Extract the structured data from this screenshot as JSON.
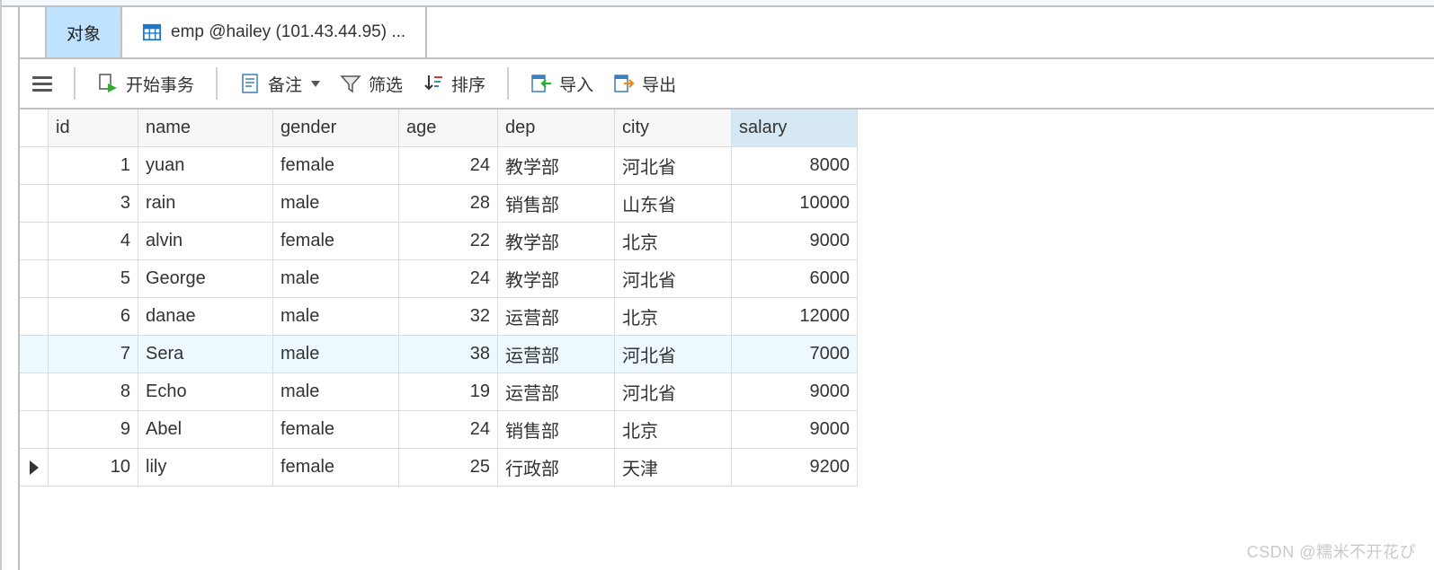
{
  "tabs": {
    "active_label": "对象",
    "inactive_label": "emp @hailey (101.43.44.95) ..."
  },
  "toolbar": {
    "begin_tx": "开始事务",
    "memo": "备注",
    "filter": "筛选",
    "sort": "排序",
    "import": "导入",
    "export": "导出"
  },
  "columns": [
    "id",
    "name",
    "gender",
    "age",
    "dep",
    "city",
    "salary"
  ],
  "sorted_column": "salary",
  "selected_row_index": 5,
  "current_row_index": 8,
  "rows": [
    {
      "id": 1,
      "name": "yuan",
      "gender": "female",
      "age": 24,
      "dep": "教学部",
      "city": "河北省",
      "salary": 8000
    },
    {
      "id": 3,
      "name": "rain",
      "gender": "male",
      "age": 28,
      "dep": "销售部",
      "city": "山东省",
      "salary": 10000
    },
    {
      "id": 4,
      "name": "alvin",
      "gender": "female",
      "age": 22,
      "dep": "教学部",
      "city": "北京",
      "salary": 9000
    },
    {
      "id": 5,
      "name": "George",
      "gender": "male",
      "age": 24,
      "dep": "教学部",
      "city": "河北省",
      "salary": 6000
    },
    {
      "id": 6,
      "name": "danae",
      "gender": "male",
      "age": 32,
      "dep": "运营部",
      "city": "北京",
      "salary": 12000
    },
    {
      "id": 7,
      "name": "Sera",
      "gender": "male",
      "age": 38,
      "dep": "运营部",
      "city": "河北省",
      "salary": 7000
    },
    {
      "id": 8,
      "name": "Echo",
      "gender": "male",
      "age": 19,
      "dep": "运营部",
      "city": "河北省",
      "salary": 9000
    },
    {
      "id": 9,
      "name": "Abel",
      "gender": "female",
      "age": 24,
      "dep": "销售部",
      "city": "北京",
      "salary": 9000
    },
    {
      "id": 10,
      "name": "lily",
      "gender": "female",
      "age": 25,
      "dep": "行政部",
      "city": "天津",
      "salary": 9200
    }
  ],
  "watermark": "CSDN @糯米不开花ぴ"
}
